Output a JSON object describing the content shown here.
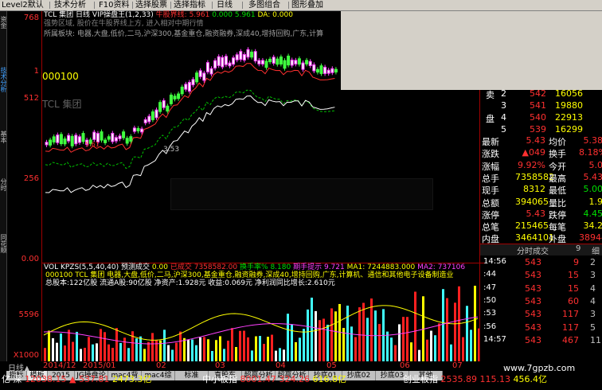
{
  "topbar": {
    "items": [
      "Level2默认",
      "技术分析",
      "F10资料",
      "选择股票",
      "选择指标",
      "日线",
      "多图组合",
      "图形叠加"
    ]
  },
  "lefttabs": [
    "资金",
    "技术分析",
    "基本",
    "分时",
    "同花顺"
  ],
  "axis": {
    "top": "768",
    "t2": "1",
    "mid": "512",
    "low": "256",
    "bot": "0.00",
    "vol": "5596",
    "volunit": "X1000"
  },
  "chart": {
    "title_code": "TCL 集团",
    "title_period": "日线",
    "title_ind": "VIP操盘王(1,2,33)",
    "title_val1": "牛股界线: 5.961",
    "title_val2": "0.000",
    "title_val3": "5.961",
    "title_da": "DA: 0.000",
    "line2": "强势区域, 股价在牛股界线上方, 进入相对中期行情",
    "line3": "所属板块: 电器,大盘,低价,二马,沪深300,基金重仓,融资融券,深成40,增持回购,广东,计算",
    "code": "000100",
    "name": "TCL 集团",
    "low_label": "3.53",
    "mark_label": "5.61"
  },
  "vol": {
    "head": "VOL KPZS(5,5,40,40)",
    "label1": "预测成交",
    "v1": "0.00",
    "label2": "已成交",
    "v2": "7358582.00",
    "label3": "换手率%",
    "v3": "8.180",
    "label4": "期手提示",
    "v4": "9.721",
    "ma1": "MA1: 7244883.000",
    "ma2": "MA2: 737106",
    "info1": "000100 TCL 集团 电器,大盘,低价,二马,沪深300,基金重仓,融资融券,深成40,增持回购,广东,计算机、通信和其他电子设备制造业",
    "info2": "总股本:122亿股  流通A股:90亿股  净资产:1.928元  收益:0.069元  净利润同比增长:2.610元"
  },
  "orderbook": [
    {
      "label": "卖",
      "lvl": "2",
      "price": "542",
      "vol": "16056"
    },
    {
      "label": "",
      "lvl": "3",
      "price": "541",
      "vol": "19880"
    },
    {
      "label": "盘",
      "lvl": "4",
      "price": "540",
      "vol": "22913"
    },
    {
      "label": "",
      "lvl": "5",
      "price": "539",
      "vol": "16299"
    }
  ],
  "quote": [
    {
      "k1": "最新",
      "v1": "5.43",
      "k2": "均价",
      "v2": "5.38"
    },
    {
      "k1": "涨跌",
      "v1": "▲049",
      "k2": "换手",
      "v2": "8.18%"
    },
    {
      "k1": "涨幅",
      "v1": "9.92%",
      "k2": "今开",
      "v2": "5.0"
    },
    {
      "k1": "总手",
      "v1": "7358582",
      "k2": "最高",
      "v2": "5.43"
    },
    {
      "k1": "现手",
      "v1": "8312",
      "k2": "最低",
      "v2": "5.00"
    },
    {
      "k1": "总额",
      "v1": "394065",
      "k2": "量比",
      "v2": "1.9"
    },
    {
      "k1": "涨停",
      "v1": "5.43",
      "k2": "跌停",
      "v2": "4.45"
    },
    {
      "k1": "总笔",
      "v1": "215465",
      "k2": "每笔",
      "v2": "34.2"
    },
    {
      "k1": "内盘",
      "v1": "3464101",
      "k2": "外盘",
      "v2": "3894487"
    }
  ],
  "trades_header": {
    "title": "分时成交",
    "n1": "9",
    "n2": "细"
  },
  "trades": [
    {
      "time": "14:56",
      "price": "543",
      "vol": "9",
      "n": "2"
    },
    {
      "time": ":44",
      "price": "543",
      "vol": "15",
      "n": "3"
    },
    {
      "time": ":47",
      "price": "543",
      "vol": "15",
      "n": "4"
    },
    {
      "time": ":50",
      "price": "543",
      "vol": "60",
      "n": "4"
    },
    {
      "time": ":53",
      "price": "543",
      "vol": "117",
      "n": "3"
    },
    {
      "time": ":56",
      "price": "543",
      "vol": "117",
      "n": "5"
    },
    {
      "time": "14:57",
      "price": "543",
      "vol": "467",
      "n": "11"
    }
  ],
  "dates": [
    "日线▲",
    "2014/12",
    "2015/01",
    "02",
    "03",
    "04",
    "05",
    "06",
    "07"
  ],
  "bottom_tabs": [
    "指标",
    "模板",
    "2015",
    "JG操盘论",
    "mac4背离",
    "mac4综合",
    "标准",
    "直股东",
    "超赢分析",
    "超赢分析",
    "抄底01",
    "抄底02",
    "抄底03",
    "其他"
  ],
  "status": [
    {
      "name": "亿 深",
      "val": "12038.15",
      "chg": "▲ 537.81",
      "amt": "2473.3亿"
    },
    {
      "name": "中小板指",
      "val": "8001.47",
      "chg": "324.26",
      "amt": "616.8亿"
    },
    {
      "name": "创业板指",
      "val": "2535.89",
      "chg": "115.13",
      "amt": "456.4亿"
    }
  ],
  "watermark": "www.7gpzb.com",
  "colors": {
    "up": "#ff3030",
    "down": "#00e000",
    "bg": "#000000"
  }
}
